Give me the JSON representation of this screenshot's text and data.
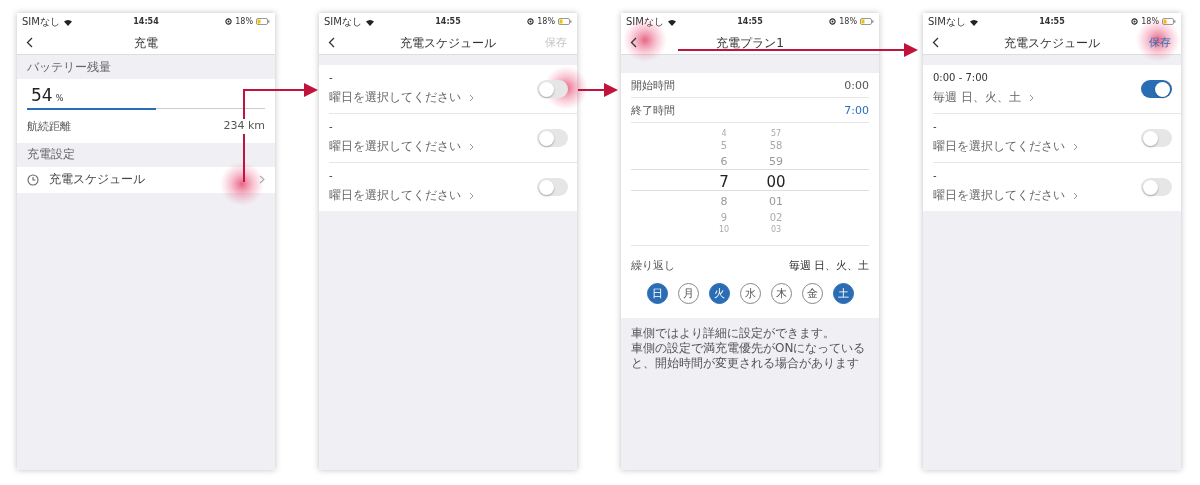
{
  "screens": [
    {
      "kind": "charge",
      "status_bar": {
        "carrier": "SIMなし",
        "time": "14:54",
        "battery": "18%"
      },
      "title": "充電",
      "battery_label": "バッテリー残量",
      "battery_value": "54",
      "battery_unit": "%",
      "level": 0.54,
      "range_label": "航続距離",
      "range_value": "234 km",
      "settings_label": "充電設定",
      "menu_item": "充電スケジュール"
    },
    {
      "kind": "schedule",
      "status_bar": {
        "carrier": "SIMなし",
        "time": "14:55",
        "battery": "18%"
      },
      "title": "充電スケジュール",
      "save": {
        "label": "保存",
        "disabled": true
      },
      "plans": [
        {
          "time": "-",
          "days": "曜日を選択してください",
          "on": false
        },
        {
          "time": "-",
          "days": "曜日を選択してください",
          "on": false
        },
        {
          "time": "-",
          "days": "曜日を選択してください",
          "on": false
        }
      ]
    },
    {
      "kind": "plan",
      "status_bar": {
        "carrier": "SIMなし",
        "time": "14:55",
        "battery": "18%"
      },
      "title": "充電プラン1",
      "times": [
        {
          "label": "開始時間",
          "value": "0:00",
          "selected": false
        },
        {
          "label": "終了時間",
          "value": "7:00",
          "selected": true
        }
      ],
      "picker": {
        "hours": [
          "4",
          "5",
          "6",
          "7",
          "8",
          "9",
          "10"
        ],
        "minutes": [
          "57",
          "58",
          "59",
          "00",
          "01",
          "02",
          "03"
        ]
      },
      "repeat_label": "繰り返し",
      "repeat_value": "毎週 日、火、土",
      "days": [
        {
          "label": "日",
          "selected": true
        },
        {
          "label": "月",
          "selected": false
        },
        {
          "label": "火",
          "selected": true
        },
        {
          "label": "水",
          "selected": false
        },
        {
          "label": "木",
          "selected": false
        },
        {
          "label": "金",
          "selected": false
        },
        {
          "label": "土",
          "selected": true
        }
      ],
      "notes": [
        "車側ではより詳細に設定ができます。",
        "車側の設定で満充電優先がONになっていると、開始時間が変更される場合があります"
      ]
    },
    {
      "kind": "schedule",
      "status_bar": {
        "carrier": "SIMなし",
        "time": "14:55",
        "battery": "18%"
      },
      "title": "充電スケジュール",
      "save": {
        "label": "保存",
        "disabled": false
      },
      "plans": [
        {
          "time": "0:00 - 7:00",
          "days": "毎週 日、火、土",
          "on": true
        },
        {
          "time": "-",
          "days": "曜日を選択してください",
          "on": false
        },
        {
          "time": "-",
          "days": "曜日を選択してください",
          "on": false
        }
      ]
    }
  ]
}
